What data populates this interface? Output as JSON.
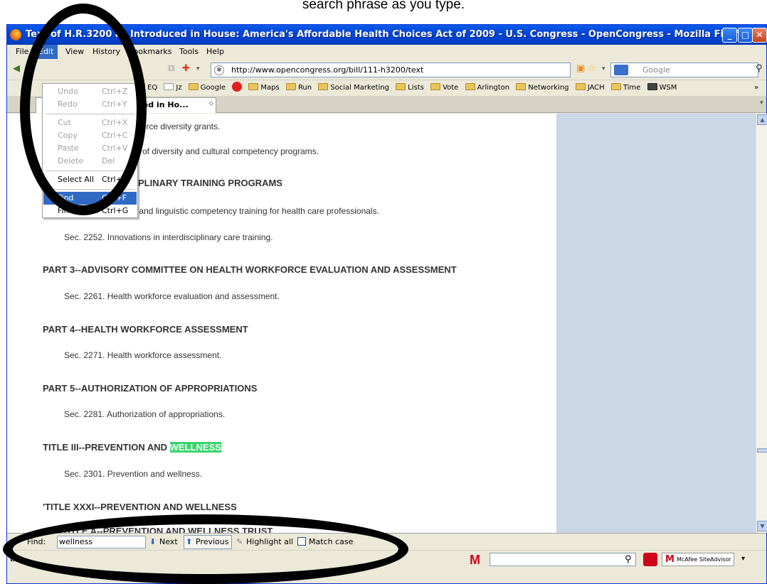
{
  "caption": "search phrase as you type.",
  "window": {
    "title": "Text of H.R.3200 as Introduced in House: America's Affordable Health Choices Act of 2009 - U.S. Congress - OpenCongress - Mozilla Firefox"
  },
  "menubar": [
    "File",
    "Edit",
    "View",
    "History",
    "Bookmarks",
    "Tools",
    "Help"
  ],
  "edit_menu": {
    "items": [
      {
        "label": "Undo",
        "shortcut": "Ctrl+Z",
        "disabled": true
      },
      {
        "label": "Redo",
        "shortcut": "Ctrl+Y",
        "disabled": true
      },
      {
        "label": "Cut",
        "shortcut": "Ctrl+X",
        "disabled": true
      },
      {
        "label": "Copy",
        "shortcut": "Ctrl+C",
        "disabled": true
      },
      {
        "label": "Paste",
        "shortcut": "Ctrl+V",
        "disabled": true
      },
      {
        "label": "Delete",
        "shortcut": "Del",
        "disabled": true
      },
      {
        "label": "Select All",
        "shortcut": "Ctrl+A",
        "disabled": false
      },
      {
        "label": "Find",
        "shortcut": "Ctrl+F",
        "disabled": false
      },
      {
        "label": "Find Again",
        "shortcut": "Ctrl+G",
        "disabled": false
      }
    ]
  },
  "navbar": {
    "url": "http://www.opencongress.org/bill/111-h3200/text",
    "search_placeholder": "Google"
  },
  "bookmarks": [
    "EQ",
    "Jz",
    "Google",
    "Maps",
    "Run",
    "Social Marketing",
    "Lists",
    "Vote",
    "Arlington",
    "Networking",
    "JACH",
    "Time",
    "WSM"
  ],
  "tab": {
    "label": "oduced in Ho..."
  },
  "content": {
    "lines": [
      "g workforce diversity grants.",
      "n of diversity and cultural competency programs."
    ],
    "heading_partial": "PLINARY TRAINING PROGRAMS",
    "sec2251": "Sec. 2251. Cultural and linguistic competency training for health care professionals.",
    "sec2252": "Sec. 2252. Innovations in interdisciplinary care training.",
    "part3": "PART 3--ADVISORY COMMITTEE ON HEALTH WORKFORCE EVALUATION AND ASSESSMENT",
    "sec2261": "Sec. 2261. Health workforce evaluation and assessment.",
    "part4": "PART 4--HEALTH WORKFORCE ASSESSMENT",
    "sec2271": "Sec. 2271. Health workforce assessment.",
    "part5": "PART 5--AUTHORIZATION OF APPROPRIATIONS",
    "sec2281": "Sec. 2281. Authorization of appropriations.",
    "title3_prefix": "TITLE III--PREVENTION AND ",
    "title3_highlight": "WELLNESS",
    "sec2301": "Sec. 2301. Prevention and wellness.",
    "title31": "'TITLE XXXI--PREVENTION AND WELLNESS",
    "subtitleA": "SUBTITLE A--PREVENTION AND WELLNESS TRUST"
  },
  "findbar": {
    "label": "Find:",
    "value": "wellness",
    "next": "Next",
    "previous": "Previous",
    "highlight": "Highlight all",
    "matchcase": "Match case"
  },
  "statusbar": {
    "text": "Do",
    "siteadvisor": "McAfee SiteAdvisor"
  }
}
